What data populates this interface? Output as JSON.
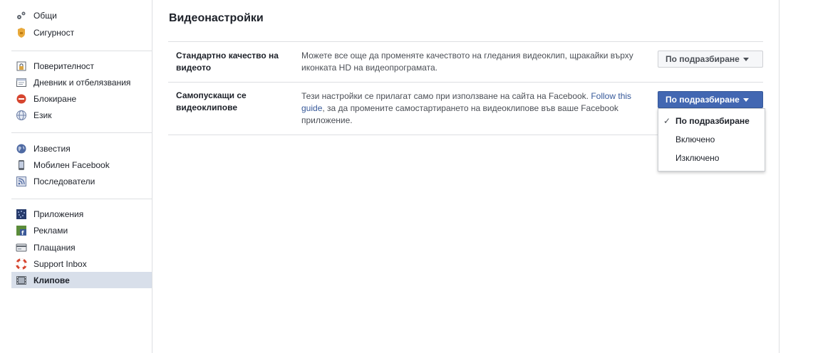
{
  "sidebar": {
    "groups": [
      [
        {
          "label": "Общи",
          "icon": "gears-icon"
        },
        {
          "label": "Сигурност",
          "icon": "security-badge-icon"
        }
      ],
      [
        {
          "label": "Поверителност",
          "icon": "lock-icon"
        },
        {
          "label": "Дневник и отбелязвания",
          "icon": "timeline-icon"
        },
        {
          "label": "Блокиране",
          "icon": "block-icon"
        },
        {
          "label": "Език",
          "icon": "globe-icon"
        }
      ],
      [
        {
          "label": "Известия",
          "icon": "notifications-globe-icon"
        },
        {
          "label": "Мобилен Facebook",
          "icon": "mobile-icon"
        },
        {
          "label": "Последователи",
          "icon": "rss-icon"
        }
      ],
      [
        {
          "label": "Приложения",
          "icon": "apps-icon"
        },
        {
          "label": "Реклами",
          "icon": "ads-icon"
        },
        {
          "label": "Плащания",
          "icon": "credit-card-icon"
        },
        {
          "label": "Support Inbox",
          "icon": "lifebuoy-icon"
        },
        {
          "label": "Клипове",
          "icon": "film-icon",
          "active": true
        }
      ]
    ]
  },
  "main": {
    "title": "Видеонастройки",
    "rows": [
      {
        "label": "Стандартно качество на видеото",
        "description": "Можете все още да променяте качеството на гледания видеоклип, щракайки върху иконката HD на видеопрограмата.",
        "button": "По подразбиране"
      },
      {
        "label": "Самопускащи се видеоклипове",
        "description_before": "Тези настройки се прилагат само при използване на сайта на Facebook. ",
        "link": "Follow this guide",
        "description_after": ", за да промените самостартирането на видеоклипове във ваше Facebook приложение.",
        "button": "По подразбиране"
      }
    ],
    "dropdown": {
      "options": [
        "По подразбиране",
        "Включено",
        "Изключено"
      ],
      "selected": 0
    }
  }
}
